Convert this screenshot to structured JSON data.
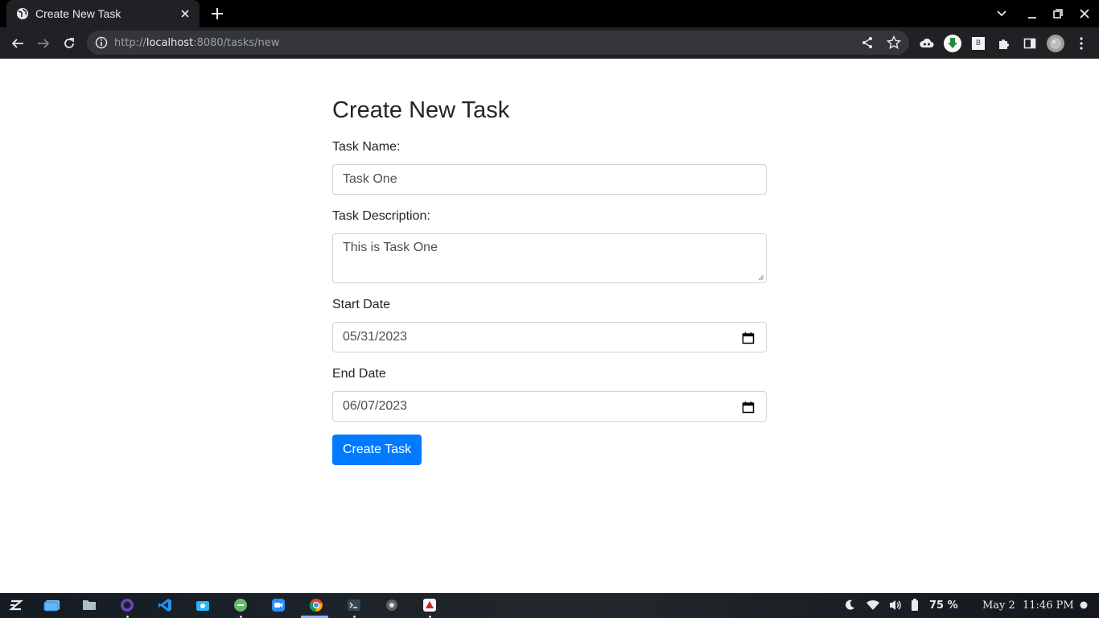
{
  "browser": {
    "tab_title": "Create New Task",
    "url_scheme": "http://",
    "url_host": "localhost",
    "url_path": ":8080/tasks/new",
    "extension_label": "B"
  },
  "page": {
    "title": "Create New Task",
    "task_name_label": "Task Name:",
    "task_name_value": "Task One",
    "task_description_label": "Task Description:",
    "task_description_value": "This is Task One",
    "start_date_label": "Start Date",
    "start_date_value": "05/31/2023",
    "end_date_label": "End Date",
    "end_date_value": "06/07/2023",
    "submit_label": "Create Task"
  },
  "taskbar": {
    "battery_percent": "75 %",
    "date": "May 2",
    "time": "11:46 PM"
  },
  "colors": {
    "primary_button": "#007bff",
    "browser_chrome": "#202124",
    "download_icon": "#1e8e3e"
  }
}
